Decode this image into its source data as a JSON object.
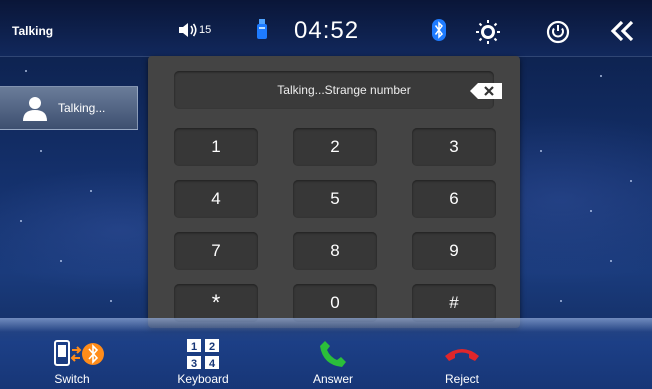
{
  "status": {
    "title": "Talking",
    "volume": "15",
    "time": "04:52"
  },
  "contact": {
    "label": "Talking..."
  },
  "dialer": {
    "display": "Talking...Strange number",
    "keys": [
      "1",
      "2",
      "3",
      "4",
      "5",
      "6",
      "7",
      "8",
      "9",
      "*",
      "0",
      "#"
    ]
  },
  "bottom": {
    "switch_label": "Switch",
    "keyboard_label": "Keyboard",
    "keyboard_digits": [
      "1",
      "2",
      "3",
      "4"
    ],
    "answer_label": "Answer",
    "reject_label": "Reject"
  },
  "colors": {
    "bluetooth": "#1e7bff",
    "accent_orange": "#ff8c1a",
    "answer_green": "#2bbf3a",
    "reject_red": "#e0262b"
  }
}
